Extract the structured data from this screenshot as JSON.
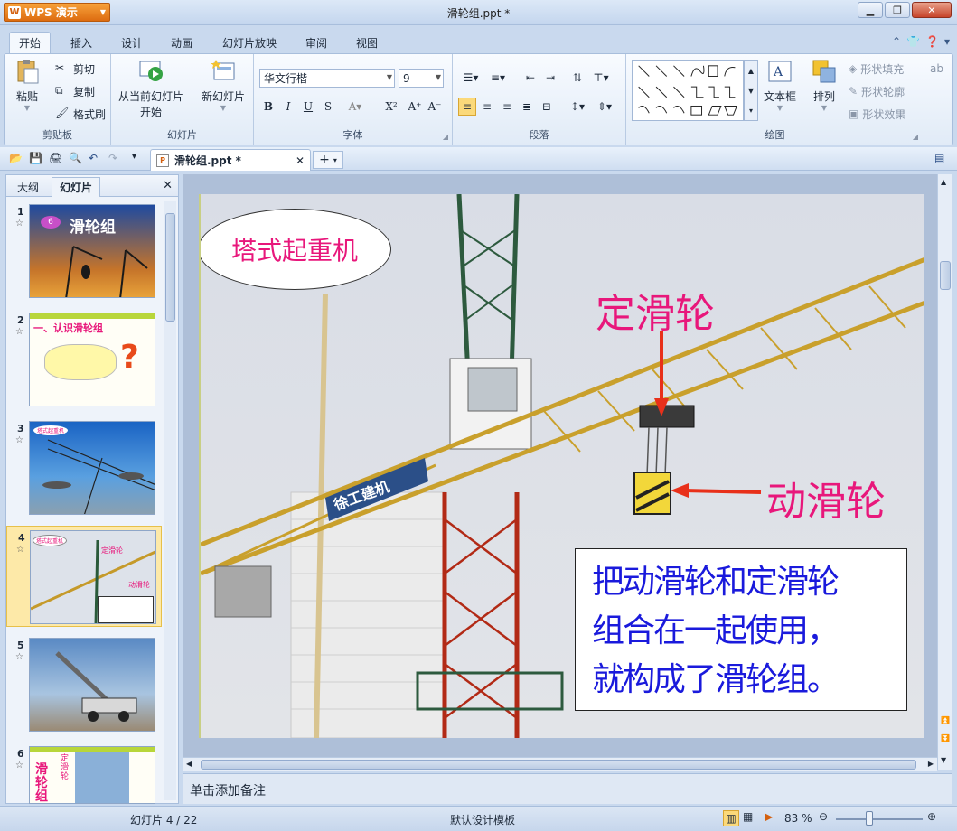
{
  "app": {
    "menu_label": "WPS 演示",
    "window_title": "滑轮组.ppt *"
  },
  "window_buttons": {
    "minimize": "▁",
    "restore": "❐",
    "close": "✕"
  },
  "ribbon_tabs": [
    "开始",
    "插入",
    "设计",
    "动画",
    "幻灯片放映",
    "审阅",
    "视图"
  ],
  "ribbon": {
    "clipboard": {
      "paste": "粘贴",
      "cut": "剪切",
      "copy": "复制",
      "format_painter": "格式刷",
      "label": "剪贴板"
    },
    "slides": {
      "from_current_line1": "从当前幻灯片",
      "from_current_line2": "开始",
      "new_slide": "新幻灯片",
      "label": "幻灯片"
    },
    "font": {
      "font_name": "华文行楷",
      "font_size": "9",
      "label": "字体"
    },
    "paragraph": {
      "label": "段落"
    },
    "drawing": {
      "text_box": "文本框",
      "arrange": "排列",
      "shape_fill": "形状填充",
      "shape_outline": "形状轮廓",
      "shape_effect": "形状效果",
      "label": "绘图"
    }
  },
  "document_tab": {
    "name": "滑轮组.ppt *"
  },
  "left_panel": {
    "tabs": [
      "大纲",
      "幻灯片"
    ],
    "thumbnails": [
      {
        "num": "1",
        "badge": "6",
        "title": "滑轮组"
      },
      {
        "num": "2",
        "title": "一、认识滑轮组"
      },
      {
        "num": "3",
        "label": "塔式起重机"
      },
      {
        "num": "4",
        "label": "塔式起重机",
        "fixed": "定滑轮",
        "movable": "动滑轮"
      },
      {
        "num": "5"
      },
      {
        "num": "6",
        "title": "滑轮组",
        "vertical": "定滑轮"
      }
    ]
  },
  "slide": {
    "oval_label": "塔式起重机",
    "fixed_pulley": "定滑轮",
    "movable_pulley": "动滑轮",
    "crane_sign": "徐工建机",
    "text_line1": "把动滑轮和定滑轮",
    "text_line2": "组合在一起使用，",
    "text_line3": "就构成了滑轮组。"
  },
  "notes_placeholder": "单击添加备注",
  "status_bar": {
    "slide_counter": "幻灯片 4 / 22",
    "template": "默认设计模板",
    "zoom": "83 %"
  },
  "colors": {
    "accent_pink": "#e8177b",
    "text_blue": "#1a1adc",
    "arrow_red": "#e8301a"
  }
}
